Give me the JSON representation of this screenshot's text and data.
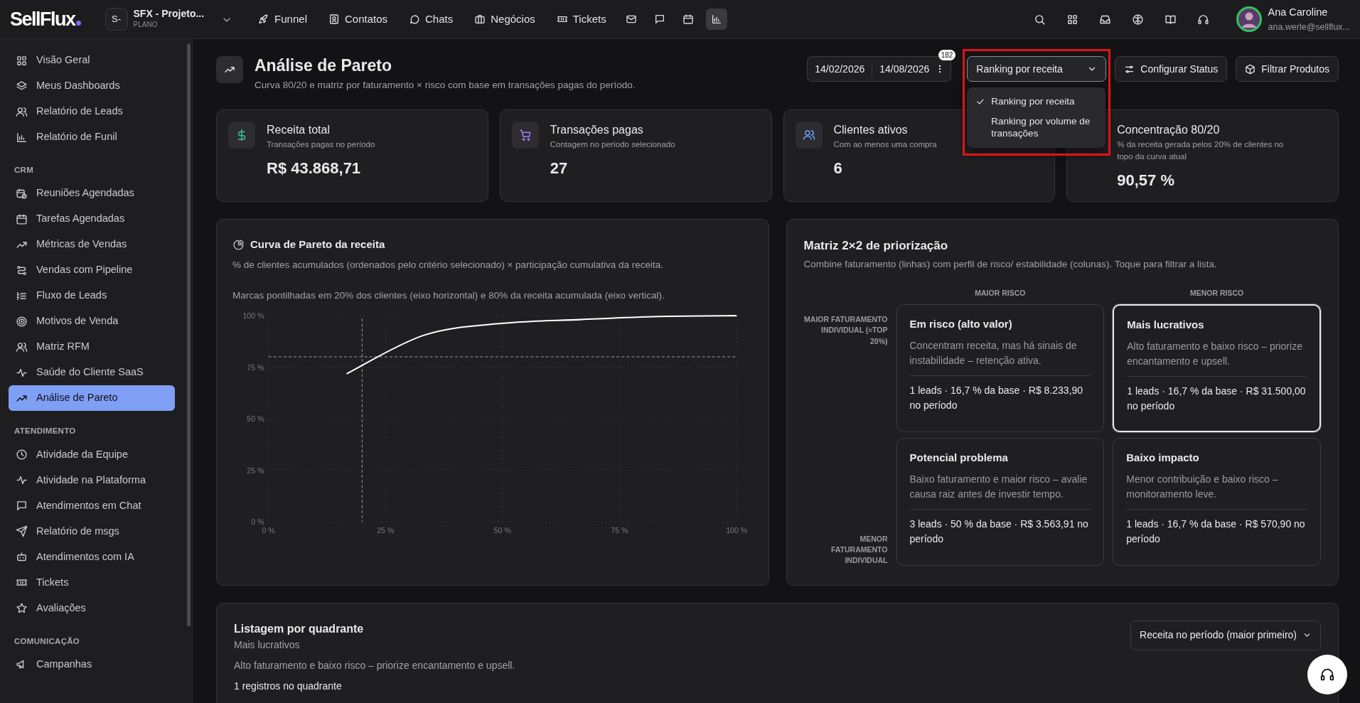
{
  "topbar": {
    "logo": "SellFlux",
    "workspace": {
      "initials": "S-",
      "name": "SFX - Projeto...",
      "plan": "PLANO"
    },
    "nav": [
      {
        "label": "Funnel"
      },
      {
        "label": "Contatos"
      },
      {
        "label": "Chats"
      },
      {
        "label": "Negócios"
      },
      {
        "label": "Tickets"
      }
    ],
    "nav_icons": [
      {
        "selected": false
      },
      {
        "selected": false
      },
      {
        "selected": false
      },
      {
        "selected": true
      }
    ],
    "user": {
      "name": "Ana Caroline",
      "email": "ana.werle@sellflux..."
    }
  },
  "sidebar": {
    "sections": [
      {
        "items": [
          {
            "label": "Visão Geral",
            "selected": false
          },
          {
            "label": "Meus Dashboards",
            "selected": false
          },
          {
            "label": "Relatório de Leads",
            "selected": false
          },
          {
            "label": "Relatório de Funil",
            "selected": false
          }
        ]
      },
      {
        "heading": "CRM",
        "items": [
          {
            "label": "Reuniões Agendadas",
            "selected": false
          },
          {
            "label": "Tarefas Agendadas",
            "selected": false
          },
          {
            "label": "Métricas de Vendas",
            "selected": false
          },
          {
            "label": "Vendas com Pipeline",
            "selected": false
          },
          {
            "label": "Fluxo de Leads",
            "selected": false
          },
          {
            "label": "Motivos de Venda",
            "selected": false
          },
          {
            "label": "Matriz RFM",
            "selected": false
          },
          {
            "label": "Saúde do Cliente SaaS",
            "selected": false
          },
          {
            "label": "Análise de Pareto",
            "selected": true
          }
        ]
      },
      {
        "heading": "ATENDIMENTO",
        "items": [
          {
            "label": "Atividade da Equipe",
            "selected": false
          },
          {
            "label": "Atividade na Plataforma",
            "selected": false
          },
          {
            "label": "Atendimentos em Chat",
            "selected": false
          },
          {
            "label": "Relatório de msgs",
            "selected": false
          },
          {
            "label": "Atendimentos com IA",
            "selected": false
          },
          {
            "label": "Tickets",
            "selected": false
          },
          {
            "label": "Avaliações",
            "selected": false
          }
        ]
      },
      {
        "heading": "COMUNICAÇÃO",
        "items": [
          {
            "label": "Campanhas",
            "selected": false
          }
        ]
      }
    ]
  },
  "header": {
    "title": "Análise de Pareto",
    "subtitle": "Curva 80/20 e matriz por faturamento × risco com base em transações pagas do período.",
    "date_start": "14/02/2026",
    "date_end": "14/08/2026",
    "badge": "182",
    "ranking": {
      "value": "Ranking por receita",
      "expanded": true,
      "options": [
        {
          "label": "Ranking por receita",
          "selected": true
        },
        {
          "label": "Ranking por volume de transações",
          "selected": false
        }
      ]
    },
    "buttons": [
      "Configurar Status",
      "Filtrar Produtos"
    ]
  },
  "kpis": [
    {
      "title": "Receita total",
      "subtitle": "Transações pagas no período",
      "value": "R$ 43.868,71",
      "color": "#34c38f"
    },
    {
      "title": "Transações pagas",
      "subtitle": "Contagem no período selecionado",
      "value": "27",
      "color": "#a77bf3"
    },
    {
      "title": "Clientes ativos",
      "subtitle": "Com ao menos uma compra",
      "value": "6",
      "color": "#6f9cf5"
    },
    {
      "title": "Concentração 80/20",
      "subtitle": "% da receita gerada pelos 20% de clientes no topo da curva atual",
      "value": "90,57 %"
    }
  ],
  "pareto": {
    "title": "Curva de Pareto da receita",
    "description": "% de clientes acumulados (ordenados pelo critério selecionado) × participação cumulativa da receita.",
    "note": "Marcas pontilhadas em 20% dos clientes (eixo horizontal) e 80% da receita acumulada (eixo vertical).",
    "chart_data": {
      "type": "line",
      "x": [
        16.7,
        33.3,
        50,
        66.7,
        83.3,
        100
      ],
      "series": [
        {
          "color": "#ffffff",
          "values": [
            71.8,
            90.6,
            96.3,
            98.1,
            99.6,
            100
          ]
        }
      ],
      "xlim": [
        0,
        100
      ],
      "ylim": [
        0,
        100
      ],
      "xticks": [
        {
          "value": 0,
          "label": "0 %"
        },
        {
          "value": 25,
          "label": "25 %"
        },
        {
          "value": 50,
          "label": "50 %"
        },
        {
          "value": 75,
          "label": "75 %"
        },
        {
          "value": 100,
          "label": "100 %"
        }
      ],
      "yticks": [
        {
          "value": 0,
          "label": "0 %"
        },
        {
          "value": 25,
          "label": "25 %"
        },
        {
          "value": 50,
          "label": "50 %"
        },
        {
          "value": 75,
          "label": "75 %"
        },
        {
          "value": 100,
          "label": "100 %"
        }
      ],
      "grid": true,
      "ref_lines": [
        {
          "axis": "x",
          "value": 20
        },
        {
          "axis": "y",
          "value": 80
        }
      ]
    }
  },
  "matrix": {
    "title": "Matriz 2×2 de priorização",
    "subtitle": "Combine faturamento (linhas) com perfil de risco/ estabilidade (colunas). Toque para filtrar a lista.",
    "col_headers": [
      "MAIOR RISCO",
      "MENOR RISCO"
    ],
    "row_headers": [
      "MAIOR FATURAMENTO INDIVIDUAL (≈TOP 20%)",
      "MENOR FATURAMENTO INDIVIDUAL"
    ],
    "quadrants": [
      {
        "title": "Em risco (alto valor)",
        "description": "Concentram receita, mas há sinais de instabilidade – retenção ativa.",
        "stats": "1 leads · 16,7 % da base · R$ 8.233,90 no período",
        "selected": false
      },
      {
        "title": "Mais lucrativos",
        "description": "Alto faturamento e baixo risco – priorize encantamento e upsell.",
        "stats": "1 leads · 16,7 % da base · R$ 31.500,00 no período",
        "selected": true
      },
      {
        "title": "Potencial problema",
        "description": "Baixo faturamento e maior risco – avalie causa raiz antes de investir tempo.",
        "stats": "3 leads · 50 % da base · R$ 3.563,91 no período",
        "selected": false
      },
      {
        "title": "Baixo impacto",
        "description": "Menor contribuição e baixo risco – monitoramento leve.",
        "stats": "1 leads · 16,7 % da base · R$ 570,90 no período",
        "selected": false
      }
    ]
  },
  "listing": {
    "title": "Listagem por quadrante",
    "quadrant": "Mais lucrativos",
    "description": "Alto faturamento e baixo risco – priorize encantamento e upsell.",
    "count": "1 registros no quadrante",
    "sort": "Receita no período (maior primeiro)"
  }
}
